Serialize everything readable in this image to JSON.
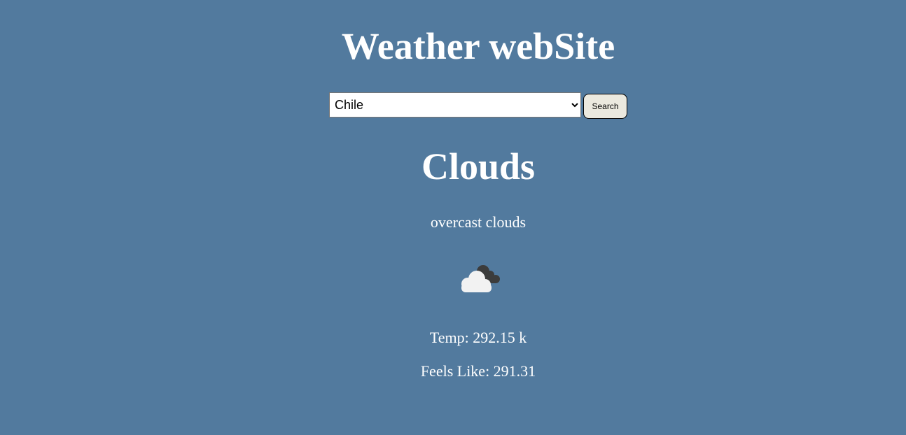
{
  "header": {
    "title": "Weather webSite"
  },
  "search": {
    "selected_country": "Chile",
    "options": [
      "Chile"
    ],
    "button_label": "Search"
  },
  "weather": {
    "main": "Clouds",
    "description": "overcast clouds",
    "icon": "overcast-clouds-icon",
    "temp_label": "Temp: 292.15 k",
    "feels_like_label": "Feels Like: 291.31"
  },
  "colors": {
    "background": "#527a9e",
    "text": "#ffffff",
    "button_bg": "#ebe9df"
  }
}
